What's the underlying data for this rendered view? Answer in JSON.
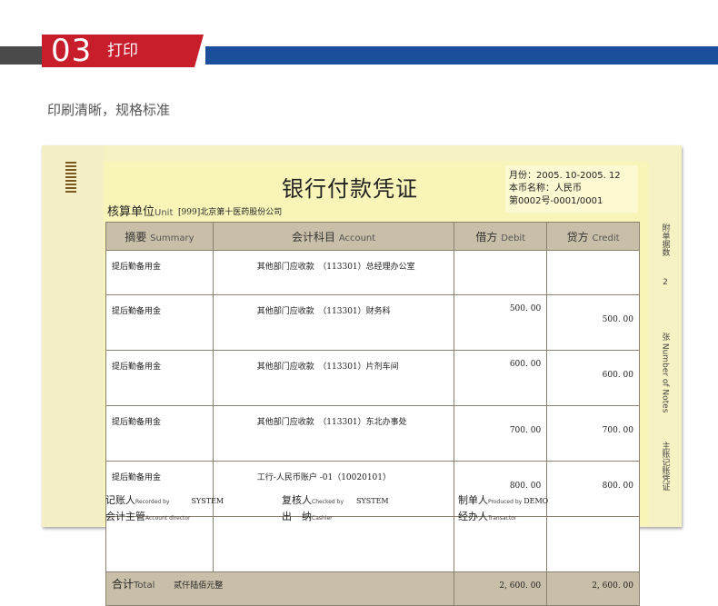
{
  "header": {
    "number": "03",
    "label": "打印"
  },
  "subtitle": "印刷清晰，规格标准",
  "voucher": {
    "title": "银行付款凭证",
    "unit_label": "核算单位",
    "unit_label_en": "Unit",
    "unit_value": "[999]北京第十医药股份公司",
    "month": "月份：2005. 10-2005. 12",
    "currency": "本币名称：人民币",
    "number": "第0002号-0001/0001",
    "columns": {
      "summary": "摘要",
      "summary_en": "Summary",
      "account": "会计科目",
      "account_en": "Account",
      "debit": "借方",
      "debit_en": "Debit",
      "credit": "贷方",
      "credit_en": "Credit"
    },
    "rows": [
      {
        "summary": "提后勤备用金",
        "account": "其他部门应收款　（113301）总经理办公室",
        "debit": "",
        "credit": ""
      },
      {
        "summary": "提后勤备用金",
        "account": "其他部门应收款　（113301）财务科",
        "debit": "500. 00",
        "credit": "500. 00"
      },
      {
        "summary": "提后勤备用金",
        "account": "其他部门应收款　（113301）片剂车间",
        "debit": "600. 00",
        "credit": "600. 00"
      },
      {
        "summary": "提后勤备用金",
        "account": "其他部门应收款　（113301）东北办事处",
        "debit": "700. 00",
        "credit": "700. 00"
      },
      {
        "summary": "提后勤备用金",
        "account": "工行-人民币账户 -01（10020101）",
        "debit": "800. 00",
        "credit": "800. 00"
      },
      {
        "summary": "",
        "account": "",
        "debit": "",
        "credit": ""
      }
    ],
    "total": {
      "label": "合计",
      "label_en": "Total",
      "words": "贰仟陆佰元整",
      "debit": "2, 600. 00",
      "credit": "2, 600. 00"
    },
    "footer": {
      "recorded_label": "记账人",
      "recorded_en": "Recorded by",
      "recorded_val": "SYSTEM",
      "checked_label": "复核人",
      "checked_en": "Checked by",
      "checked_val": "SYSTEM",
      "produced_label": "制单人",
      "produced_en": "Produced by",
      "produced_val": "DEMO",
      "director_label": "会计主管",
      "director_en": "Account director",
      "cashier_label": "出　纳",
      "cashier_en": "Cashier",
      "transactor_label": "经办人",
      "transactor_en": "Transactor"
    },
    "side": {
      "attach": "附单据数",
      "count": "2",
      "notes": "张 Number of Notes",
      "type": "主账记账凭证"
    }
  }
}
